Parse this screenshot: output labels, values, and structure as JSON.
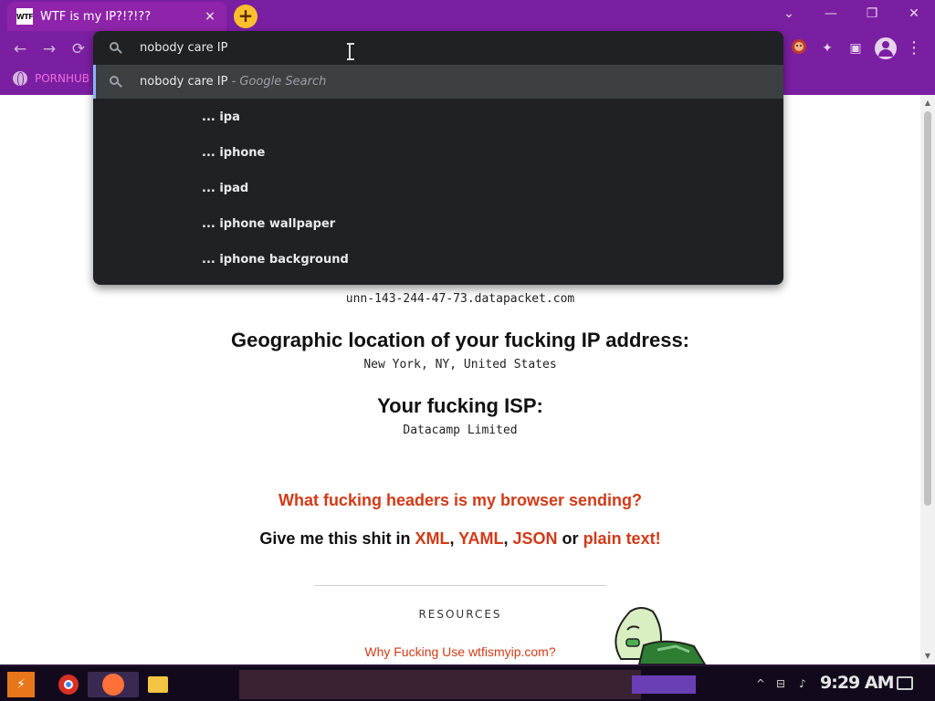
{
  "browser": {
    "tab": {
      "favicon_text": "WTF",
      "title": "WTF is my IP?!?!??",
      "close_glyph": "×"
    },
    "new_tab_glyph": "+",
    "window_controls": {
      "tabsearch": "⌄",
      "minimize": "—",
      "restore": "❐",
      "close": "✕"
    },
    "nav": {
      "back": "←",
      "forward": "→",
      "reload": "⟳"
    },
    "toolbar_icons": {
      "extensions": "✦",
      "sidepanel": "▣"
    },
    "bookmark": {
      "icon": "globe-icon",
      "label": "PORNHUB"
    }
  },
  "omnibox": {
    "input_value": "nobody care IP",
    "selected_suggestion": {
      "query": "nobody care IP",
      "suffix": " - Google Search"
    },
    "suggestions": [
      "... ipa",
      "... iphone",
      "... ipad",
      "... iphone wallpaper",
      "... iphone background"
    ]
  },
  "page": {
    "hostname": "unn-143-244-47-73.datapacket.com",
    "geo_heading": "Geographic location of your fucking IP address:",
    "geo_value": "New York, NY, United States",
    "isp_heading": "Your fucking ISP:",
    "isp_value": "Datacamp Limited",
    "headers_link": "What fucking headers is my browser sending?",
    "give_me": {
      "prefix": "Give me this shit in ",
      "xml": "XML",
      "sep1": ", ",
      "yaml": "YAML",
      "sep2": ", ",
      "json": "JSON",
      "or": " or ",
      "plain": "plain text!"
    },
    "resources_label": "RESOURCES",
    "why_link": "Why Fucking Use wtfismyip.com?"
  },
  "taskbar": {
    "clock": "9:29 AM",
    "tray_up": "^",
    "network": "⊟",
    "volume": "♪"
  },
  "colors": {
    "chrome_purple": "#7b1fa2",
    "tab_active": "#8e24aa",
    "new_tab_yellow": "#fbc02d",
    "omnibox_bg": "#202124",
    "link_red": "#d23a17"
  }
}
